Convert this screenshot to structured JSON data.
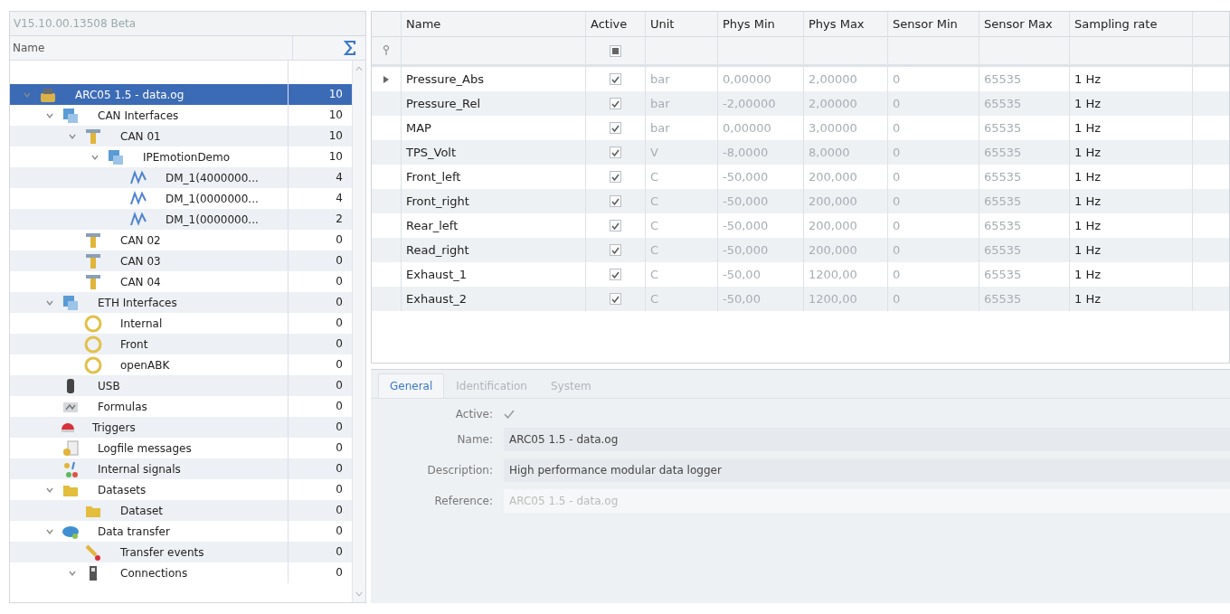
{
  "tree_panel": {
    "title": "V15.10.00.13508 Beta",
    "columns": [
      "Name"
    ],
    "items": [
      {
        "label": "ARC05 1.5 - data.og",
        "count": "10",
        "kind": "device",
        "selected": true,
        "expanded": true,
        "children": [
          {
            "label": "CAN Interfaces",
            "count": "10",
            "kind": "group",
            "selected": false,
            "expanded": true,
            "children": [
              {
                "label": "CAN 01",
                "count": "10",
                "kind": "bus",
                "selected": false,
                "expanded": true,
                "children": [
                  {
                    "label": "IPEmotionDemo",
                    "count": "10",
                    "kind": "group",
                    "selected": false,
                    "expanded": true,
                    "children": [
                      {
                        "label": "DM_1(4000000...",
                        "count": "4",
                        "kind": "signal",
                        "selected": false
                      },
                      {
                        "label": "DM_1(0000000...",
                        "count": "4",
                        "kind": "signal",
                        "selected": false
                      },
                      {
                        "label": "DM_1(0000000...",
                        "count": "2",
                        "kind": "signal",
                        "selected": false
                      }
                    ]
                  }
                ]
              },
              {
                "label": "CAN 02",
                "count": "0",
                "kind": "bus",
                "selected": false
              },
              {
                "label": "CAN 03",
                "count": "0",
                "kind": "bus",
                "selected": false
              },
              {
                "label": "CAN 04",
                "count": "0",
                "kind": "bus",
                "selected": false
              }
            ]
          },
          {
            "label": "ETH Interfaces",
            "count": "0",
            "kind": "group",
            "selected": false,
            "expanded": true,
            "children": [
              {
                "label": "Internal",
                "count": "0",
                "kind": "ethernet",
                "selected": false
              },
              {
                "label": "Front",
                "count": "0",
                "kind": "ethernet",
                "selected": false
              },
              {
                "label": "openABK",
                "count": "0",
                "kind": "ethernet",
                "selected": false
              }
            ]
          },
          {
            "label": "USB",
            "count": "0",
            "kind": "usb",
            "selected": false
          },
          {
            "label": "Formulas",
            "count": "0",
            "kind": "formula",
            "selected": false
          },
          {
            "label": "Triggers",
            "count": "0",
            "kind": "trigger",
            "selected": false
          },
          {
            "label": "Logfile messages",
            "count": "0",
            "kind": "log",
            "selected": false
          },
          {
            "label": "Internal signals",
            "count": "0",
            "kind": "signals",
            "selected": false
          },
          {
            "label": "Datasets",
            "count": "0",
            "kind": "folder",
            "selected": false,
            "expanded": true,
            "children": [
              {
                "label": "Dataset",
                "count": "0",
                "kind": "folder",
                "selected": false
              }
            ]
          },
          {
            "label": "Data transfer",
            "count": "0",
            "kind": "transfer",
            "selected": false,
            "expanded": true,
            "children": [
              {
                "label": "Transfer events",
                "count": "0",
                "kind": "events",
                "selected": false
              },
              {
                "label": "Connections",
                "count": "0",
                "kind": "connection",
                "selected": false,
                "expanded": true
              }
            ]
          }
        ]
      }
    ]
  },
  "grid": {
    "active_filter_mixed": true,
    "columns": [
      "Name",
      "Active",
      "Unit",
      "Phys Min",
      "Phys Max",
      "Sensor Min",
      "Sensor Max",
      "Sampling rate"
    ],
    "rows": [
      {
        "name": "Pressure_Abs",
        "active": true,
        "current": true,
        "unit": "bar",
        "phys_min": "0,00000",
        "phys_max": "2,00000",
        "sensor_min": "0",
        "sensor_max": "65535",
        "sampling_rate": "1 Hz"
      },
      {
        "name": "Pressure_Rel",
        "active": true,
        "current": false,
        "unit": "bar",
        "phys_min": "-2,00000",
        "phys_max": "2,00000",
        "sensor_min": "0",
        "sensor_max": "65535",
        "sampling_rate": "1 Hz"
      },
      {
        "name": "MAP",
        "active": true,
        "current": false,
        "unit": "bar",
        "phys_min": "0,00000",
        "phys_max": "3,00000",
        "sensor_min": "0",
        "sensor_max": "65535",
        "sampling_rate": "1 Hz"
      },
      {
        "name": "TPS_Volt",
        "active": true,
        "current": false,
        "unit": "V",
        "phys_min": "-8,0000",
        "phys_max": "8,0000",
        "sensor_min": "0",
        "sensor_max": "65535",
        "sampling_rate": "1 Hz"
      },
      {
        "name": "Front_left",
        "active": true,
        "current": false,
        "unit": "C",
        "phys_min": "-50,000",
        "phys_max": "200,000",
        "sensor_min": "0",
        "sensor_max": "65535",
        "sampling_rate": "1 Hz"
      },
      {
        "name": "Front_right",
        "active": true,
        "current": false,
        "unit": "C",
        "phys_min": "-50,000",
        "phys_max": "200,000",
        "sensor_min": "0",
        "sensor_max": "65535",
        "sampling_rate": "1 Hz"
      },
      {
        "name": "Rear_left",
        "active": true,
        "current": false,
        "unit": "C",
        "phys_min": "-50,000",
        "phys_max": "200,000",
        "sensor_min": "0",
        "sensor_max": "65535",
        "sampling_rate": "1 Hz"
      },
      {
        "name": "Read_right",
        "active": true,
        "current": false,
        "unit": "C",
        "phys_min": "-50,000",
        "phys_max": "200,000",
        "sensor_min": "0",
        "sensor_max": "65535",
        "sampling_rate": "1 Hz"
      },
      {
        "name": "Exhaust_1",
        "active": true,
        "current": false,
        "unit": "C",
        "phys_min": "-50,00",
        "phys_max": "1200,00",
        "sensor_min": "0",
        "sensor_max": "65535",
        "sampling_rate": "1 Hz"
      },
      {
        "name": "Exhaust_2",
        "active": true,
        "current": false,
        "unit": "C",
        "phys_min": "-50,00",
        "phys_max": "1200,00",
        "sensor_min": "0",
        "sensor_max": "65535",
        "sampling_rate": "1 Hz"
      }
    ]
  },
  "properties": {
    "tabs": [
      {
        "label": "General",
        "selected": true
      },
      {
        "label": "Identification",
        "selected": false
      },
      {
        "label": "System",
        "selected": false
      }
    ],
    "fields": [
      {
        "kind": "checkbox",
        "label": "Active:",
        "checked": true
      },
      {
        "kind": "text",
        "label": "Name:",
        "value": "ARC05 1.5 - data.og",
        "disabled": false
      },
      {
        "kind": "text",
        "label": "Description:",
        "value": "High performance modular data logger",
        "disabled": false
      },
      {
        "kind": "text",
        "label": "Reference:",
        "value": "ARC05 1.5 - data.og",
        "disabled": true
      }
    ]
  }
}
